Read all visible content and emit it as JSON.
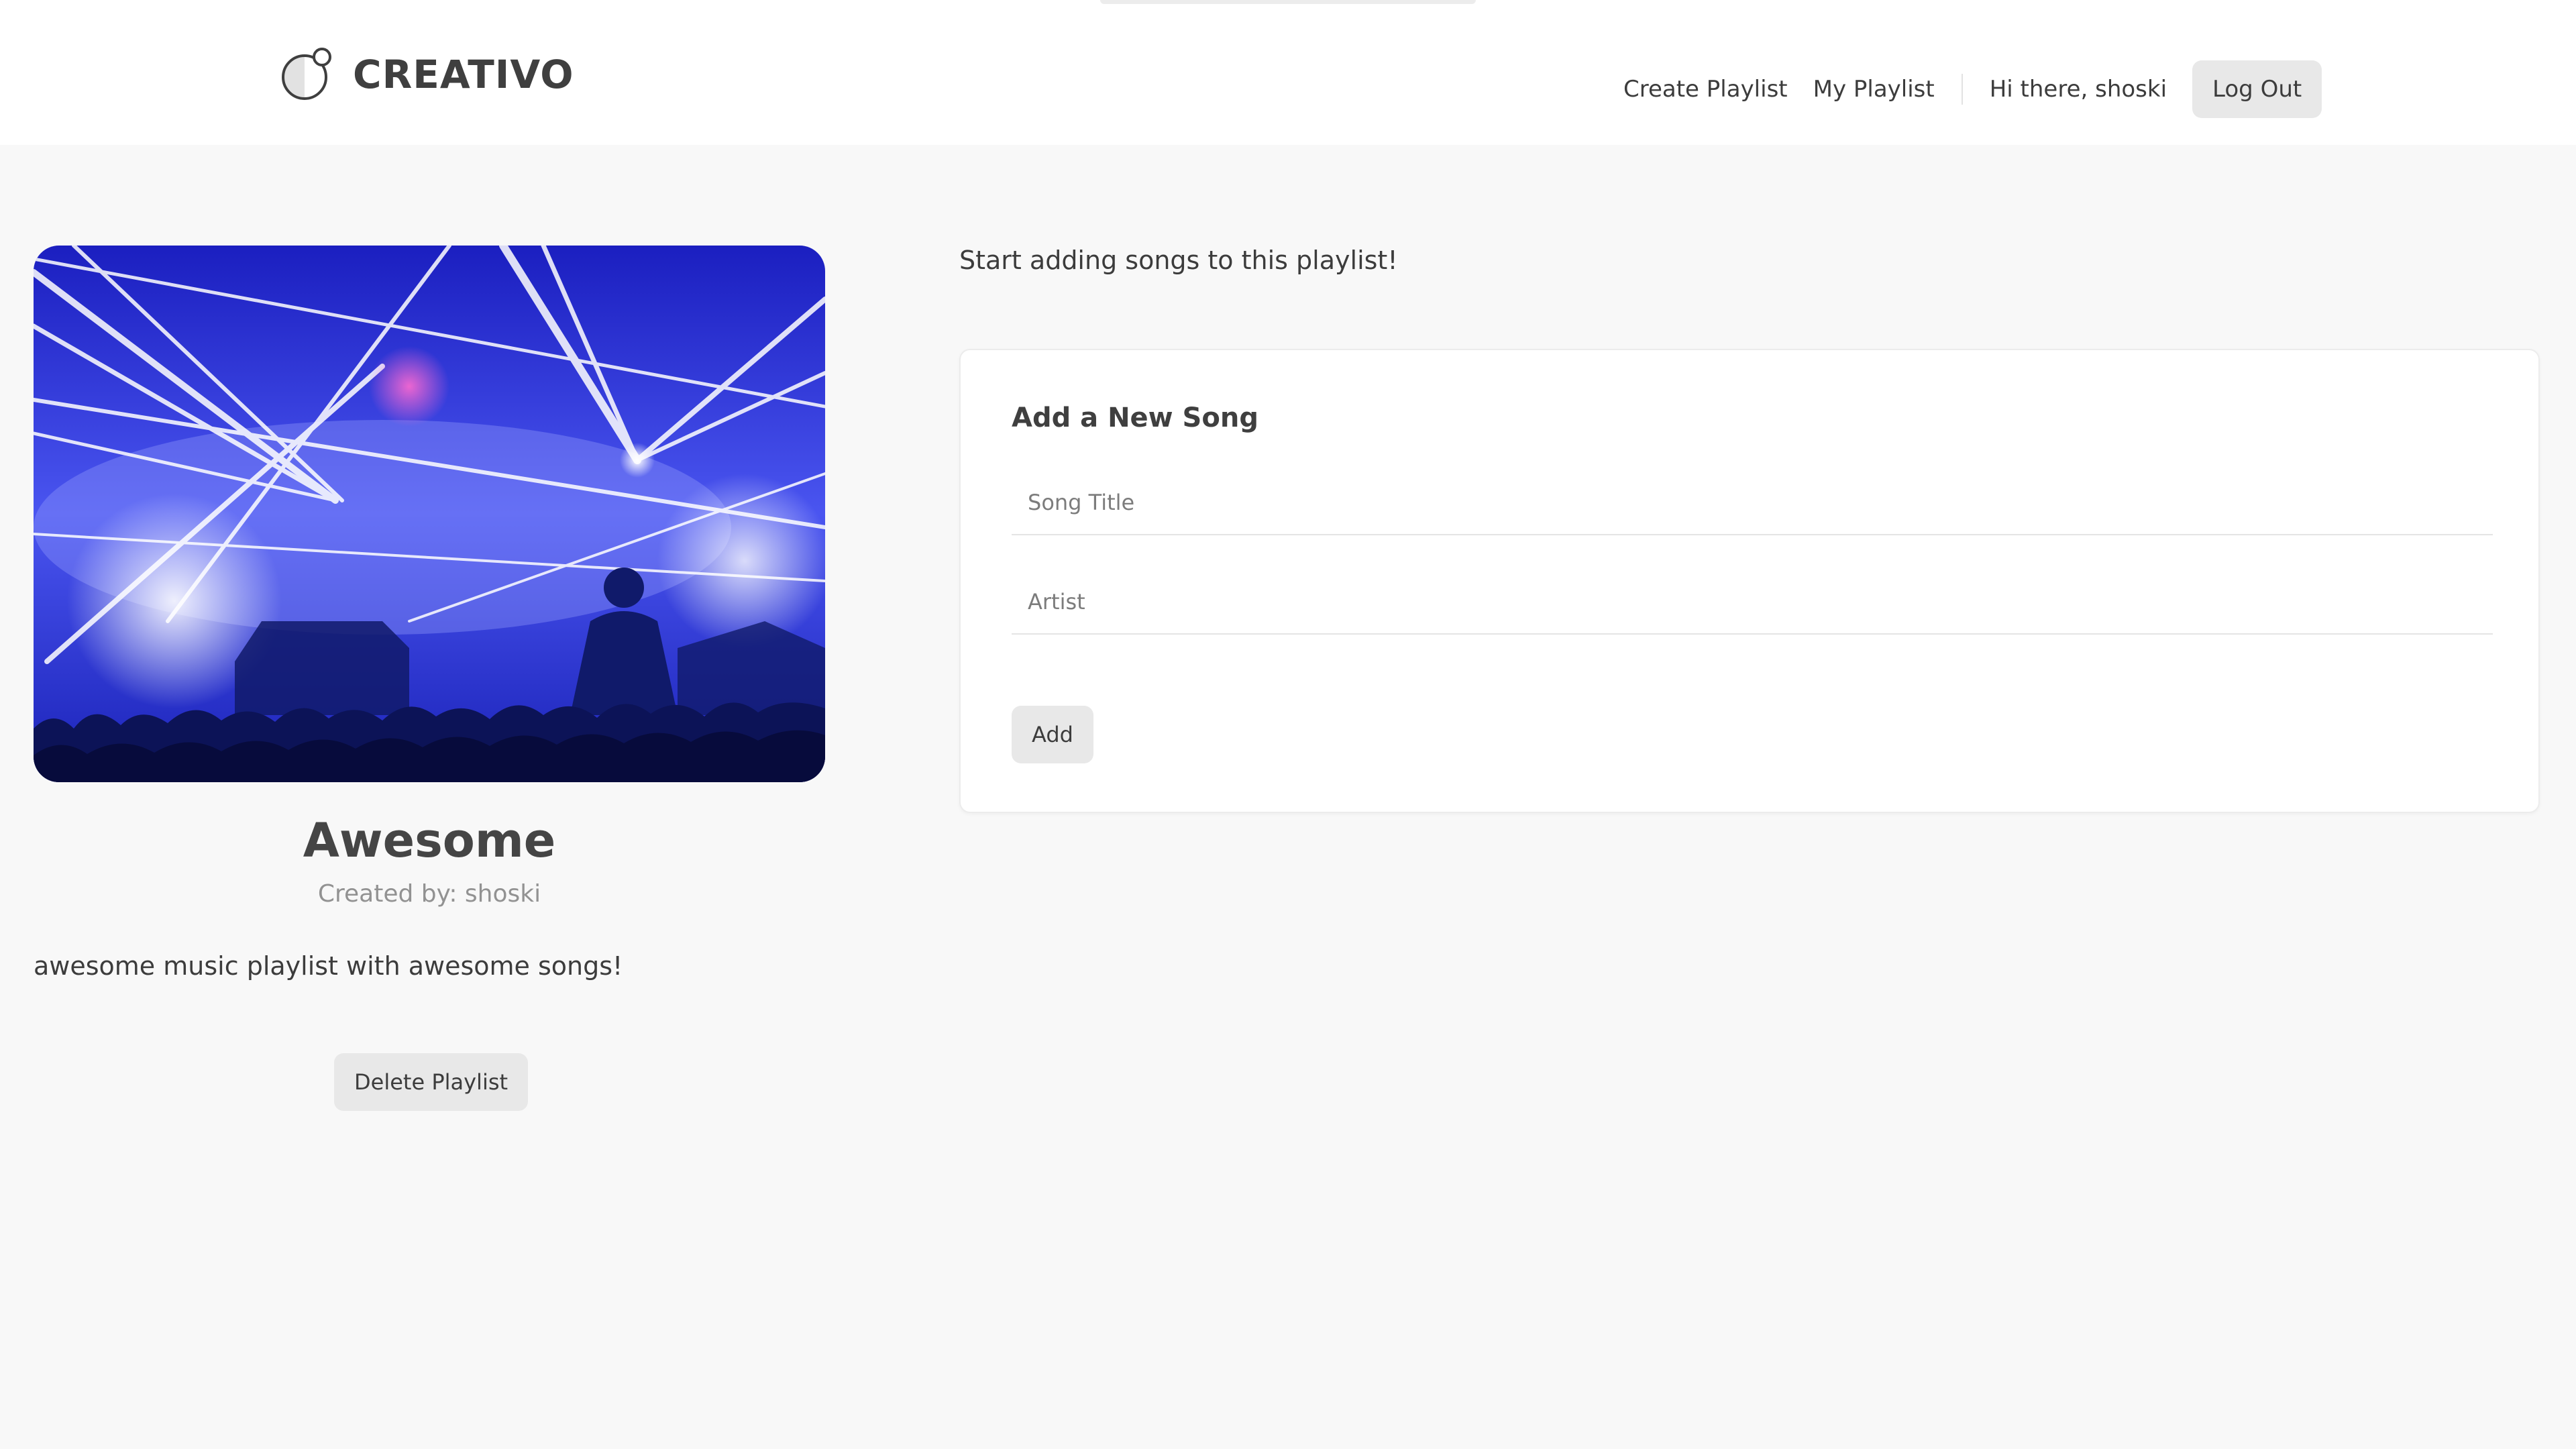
{
  "header": {
    "brand": "CREATIVO",
    "logo_icon": "circle-logo-icon",
    "nav": {
      "create_playlist": "Create Playlist",
      "my_playlist": "My Playlist",
      "greeting": "Hi there, shoski",
      "logout": "Log Out"
    }
  },
  "playlist": {
    "cover_image": "concert-lights-crowd-image",
    "title": "Awesome",
    "created_by": "Created by: shoski",
    "description": "awesome music playlist with awesome songs!",
    "delete_label": "Delete Playlist"
  },
  "songs": {
    "empty_message": "Start adding songs to this playlist!"
  },
  "add_song_form": {
    "title": "Add a New Song",
    "song_title_placeholder": "Song Title",
    "song_title_value": "",
    "artist_placeholder": "Artist",
    "artist_value": "",
    "submit_label": "Add"
  },
  "colors": {
    "page_background": "#f8f8f8",
    "header_background": "#ffffff",
    "button_background": "#e8e8e8",
    "text": "#3c3c3c",
    "muted_text": "#929292",
    "cover_blue": "#2a30d6"
  }
}
